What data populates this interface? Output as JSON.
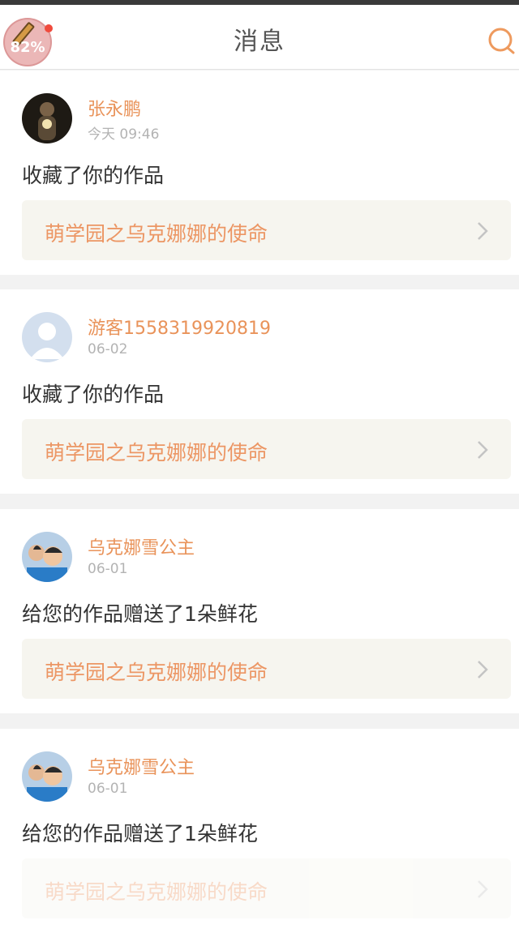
{
  "header": {
    "title": "消息",
    "widget_text": "82%",
    "icons": {
      "search": "search-icon",
      "widget": "pencil-icon"
    }
  },
  "colors": {
    "accent": "#e9935a",
    "link_bg": "#f6f5ef",
    "muted": "#b3b3b3",
    "separator": "#f2f2f2"
  },
  "messages": [
    {
      "username": "张永鹏",
      "time": "今天 09:46",
      "action": "收藏了你的作品",
      "work_title": "萌学园之乌克娜娜的使命",
      "avatar": "photo-avatar-dark"
    },
    {
      "username": "游客1558319920819",
      "time": "06-02",
      "action": "收藏了你的作品",
      "work_title": "萌学园之乌克娜娜的使命",
      "avatar": "default-user-avatar"
    },
    {
      "username": "乌克娜雪公主",
      "time": "06-01",
      "action": "给您的作品赠送了1朵鲜花",
      "work_title": "萌学园之乌克娜娜的使命",
      "avatar": "photo-avatar-two-girls"
    },
    {
      "username": "乌克娜雪公主",
      "time": "06-01",
      "action": "给您的作品赠送了1朵鲜花",
      "work_title": "萌学园之乌克娜娜的使命",
      "avatar": "photo-avatar-two-girls"
    }
  ]
}
